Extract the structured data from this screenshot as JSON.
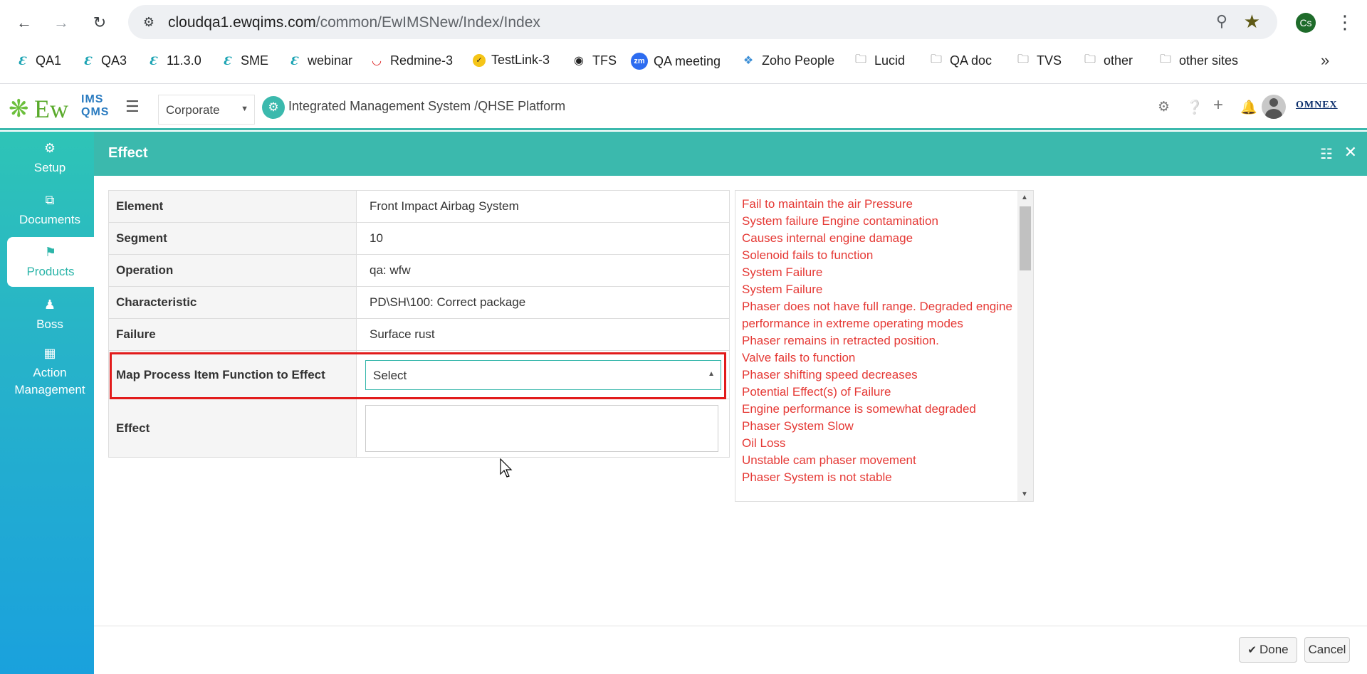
{
  "browser": {
    "url_host": "cloudqa1.ewqims.com",
    "url_path": "/common/EwIMSNew/Index/Index",
    "profile_initials": "Cs",
    "bookmarks": [
      {
        "label": "QA1",
        "icon": "ewqims-icon"
      },
      {
        "label": "QA3",
        "icon": "ewqims-icon"
      },
      {
        "label": "11.3.0",
        "icon": "ewqims-icon"
      },
      {
        "label": "SME",
        "icon": "ewqims-icon"
      },
      {
        "label": "webinar",
        "icon": "ewqims-icon"
      },
      {
        "label": "Redmine-3",
        "icon": "redmine-icon"
      },
      {
        "label": "TestLink-3",
        "icon": "testlink-icon"
      },
      {
        "label": "TFS",
        "icon": "globe-icon"
      },
      {
        "label": "QA meeting",
        "icon": "zoom-icon"
      },
      {
        "label": "Zoho People",
        "icon": "zoho-icon"
      },
      {
        "label": "Lucid",
        "icon": "folder-icon"
      },
      {
        "label": "QA doc",
        "icon": "folder-icon"
      },
      {
        "label": "TVS",
        "icon": "folder-icon"
      },
      {
        "label": "other",
        "icon": "folder-icon"
      },
      {
        "label": "other sites",
        "icon": "folder-icon"
      }
    ]
  },
  "header": {
    "logo_ew": "Ew",
    "logo_ims": "IMS",
    "logo_qms": "QMS",
    "corporate_select": "Corporate",
    "platform_title": "Integrated Management System /QHSE Platform",
    "omnex_logo": "OMNEX"
  },
  "sidebar": {
    "items": [
      {
        "label": "Setup",
        "icon": "gears-icon",
        "active": false
      },
      {
        "label": "Documents",
        "icon": "copy-icon",
        "active": false
      },
      {
        "label": "Products",
        "icon": "product-icon",
        "active": true
      },
      {
        "label": "Boss",
        "icon": "user-icon",
        "active": false
      },
      {
        "label": "Action Management",
        "icon": "building-icon",
        "active": false
      }
    ]
  },
  "modal": {
    "title": "Effect",
    "rows": [
      {
        "label": "Element",
        "value": "Front Impact Airbag System"
      },
      {
        "label": "Segment",
        "value": "10"
      },
      {
        "label": "Operation",
        "value": "qa: wfw"
      },
      {
        "label": "Characteristic",
        "value": "PD\\SH\\100: Correct package"
      },
      {
        "label": "Failure",
        "value": "Surface rust"
      }
    ],
    "map_label": "Map Process Item Function to Effect",
    "map_select_value": "Select",
    "effect_label": "Effect",
    "effect_value": "",
    "effects_list": [
      "Fail to maintain the air Pressure",
      "System failure Engine contamination",
      "Causes internal engine damage",
      "Solenoid fails to function",
      "System Failure",
      "System Failure",
      "Phaser does not have full range. Degraded engine performance in extreme operating modes",
      "Phaser remains in retracted position.",
      "Valve fails to function",
      "Phaser shifting speed decreases",
      "Potential Effect(s) of Failure",
      "Engine performance is somewhat degraded",
      "Phaser System Slow",
      "Oil Loss",
      "Unstable cam phaser movement",
      "Phaser System is not stable"
    ],
    "done_label": "Done",
    "cancel_label": "Cancel"
  },
  "colors": {
    "accent": "#3bb9ad",
    "failure_text": "#e53935",
    "characteristic_text": "#2e7d32",
    "highlight_outline": "#e21b1b"
  }
}
